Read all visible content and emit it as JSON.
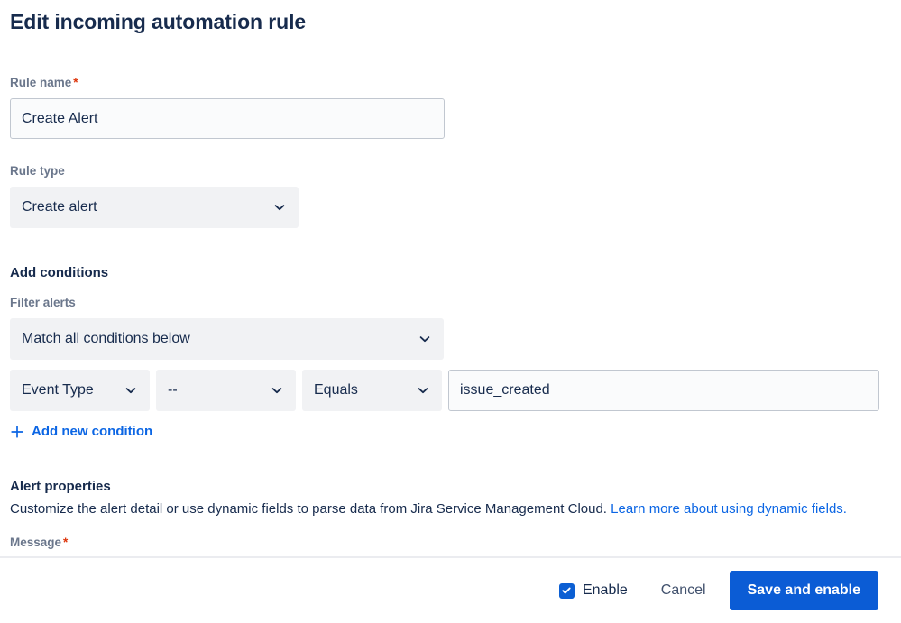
{
  "page": {
    "title": "Edit incoming automation rule"
  },
  "rule_name": {
    "label": "Rule name",
    "required_marker": "*",
    "value": "Create Alert",
    "placeholder": "Rule name"
  },
  "rule_type": {
    "label": "Rule type",
    "value": "Create alert",
    "chevron_icon": "chevron-down-icon"
  },
  "conditions": {
    "heading": "Add conditions",
    "filter_label": "Filter alerts",
    "filter_value": "Match all conditions below",
    "row": {
      "field": "Event Type",
      "key": "--",
      "operator": "Equals",
      "value": "issue_created",
      "value_placeholder": "Value"
    },
    "add_link": "Add new condition",
    "add_icon": "plus-icon"
  },
  "alert_properties": {
    "heading": "Alert properties",
    "description_prefix": "Customize the alert detail or use dynamic fields to parse data from Jira Service Management Cloud. ",
    "description_link": "Learn more about using dynamic fields.",
    "message_label": "Message",
    "message_required_marker": "*"
  },
  "footer": {
    "enable_label": "Enable",
    "enable_checked": true,
    "check_icon": "check-icon",
    "cancel_label": "Cancel",
    "save_label": "Save and enable"
  },
  "colors": {
    "accent_blue": "#0C66E4",
    "primary_button": "#0B5CD5",
    "text_dark": "#172B4D",
    "label_gray": "#6B778C",
    "required_red": "#DE350B",
    "field_gray": "#F1F2F4",
    "input_bg": "#FAFBFC",
    "input_border": "#C1C7D0",
    "divider": "#EBECF0"
  }
}
